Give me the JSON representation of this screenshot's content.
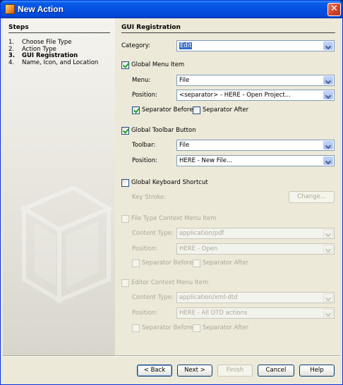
{
  "window": {
    "title": "New Action",
    "close_glyph": "✕"
  },
  "steps": {
    "title": "Steps",
    "items": [
      {
        "num": "1.",
        "label": "Choose File Type"
      },
      {
        "num": "2.",
        "label": "Action Type"
      },
      {
        "num": "3.",
        "label": "GUI Registration"
      },
      {
        "num": "4.",
        "label": "Name, Icon, and Location"
      }
    ]
  },
  "main": {
    "title": "GUI Registration",
    "category": {
      "label": "Category:",
      "value": "Edit"
    },
    "global_menu": {
      "label": "Global Menu Item",
      "checked": true,
      "menu_label": "Menu:",
      "menu_value": "File",
      "position_label": "Position:",
      "position_value": "<separator> - HERE - Open Project...",
      "sep_before": "Separator Before",
      "sep_after": "Separator After"
    },
    "global_toolbar": {
      "label": "Global Toolbar Button",
      "checked": true,
      "toolbar_label": "Toolbar:",
      "toolbar_value": "File",
      "position_label": "Position:",
      "position_value": "HERE - New File..."
    },
    "keyboard": {
      "label": "Global Keyboard Shortcut",
      "checked": false,
      "keystroke_label": "Key Stroke:",
      "change_button": "Change..."
    },
    "file_type_ctx": {
      "label": "File Type Context Menu Item",
      "checked": false,
      "content_type_label": "Content Type:",
      "content_type_value": "application/pdf",
      "position_label": "Position:",
      "position_value": "HERE - Open",
      "sep_before": "Separator Before",
      "sep_after": "Separator After"
    },
    "editor_ctx": {
      "label": "Editor Context Menu Item",
      "checked": false,
      "content_type_label": "Content Type:",
      "content_type_value": "application/xml-dtd",
      "position_label": "Position:",
      "position_value": "HERE - All DTD actions",
      "sep_before": "Separator Before",
      "sep_after": "Separator After"
    }
  },
  "buttons": {
    "back": "< Back",
    "next": "Next >",
    "finish": "Finish",
    "cancel": "Cancel",
    "help": "Help"
  }
}
